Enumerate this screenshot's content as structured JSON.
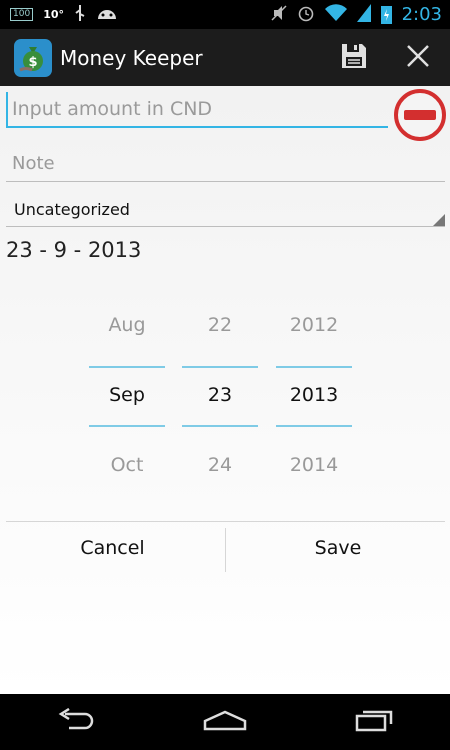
{
  "status_bar": {
    "battery_level": "100",
    "temperature": "10°",
    "time": "2:03",
    "icons": [
      "usb-icon",
      "android-icon",
      "mute-icon",
      "alarm-icon",
      "wifi-icon",
      "signal-icon",
      "battery-charging-icon"
    ]
  },
  "action_bar": {
    "title": "Money Keeper",
    "actions": [
      "save-icon",
      "close-icon"
    ]
  },
  "form": {
    "amount_placeholder": "Input amount in CND",
    "amount_value": "",
    "note_placeholder": "Note",
    "note_value": "",
    "category": "Uncategorized",
    "date_display": "23 - 9 - 2013"
  },
  "date_picker": {
    "month": {
      "prev": "Aug",
      "current": "Sep",
      "next": "Oct"
    },
    "day": {
      "prev": "22",
      "current": "23",
      "next": "24"
    },
    "year": {
      "prev": "2012",
      "current": "2013",
      "next": "2014"
    }
  },
  "dialog": {
    "cancel_label": "Cancel",
    "save_label": "Save"
  },
  "colors": {
    "accent": "#33b5e5",
    "minus_red": "#d32f2f",
    "action_bar": "#1c1c1c"
  }
}
